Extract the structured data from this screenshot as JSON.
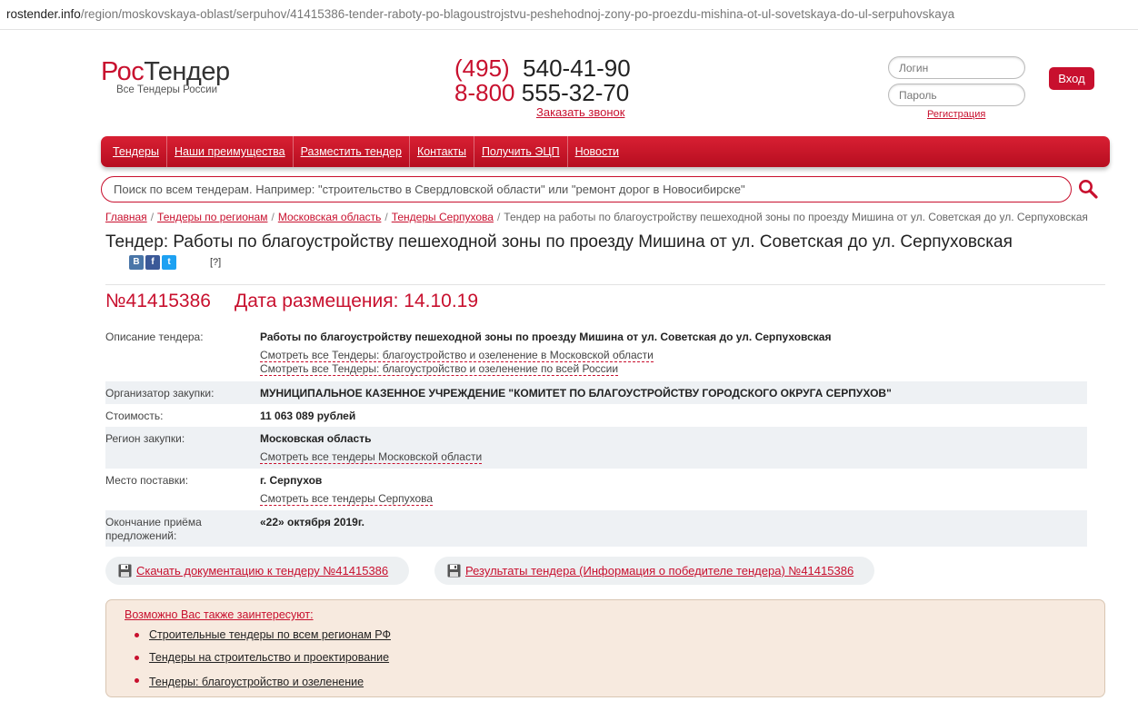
{
  "url": {
    "host": "rostender.info",
    "path": "/region/moskovskaya-oblast/serpuhov/41415386-tender-raboty-po-blagoustrojstvu-peshehodnoj-zony-po-proezdu-mishina-ot-ul-sovetskaya-do-ul-serpuhovskaya"
  },
  "header": {
    "brand_part1": "Рос",
    "brand_part2": "Тендер",
    "slogan": "Все Тендеры России",
    "phone1_code": "(495)",
    "phone1_number": "540-41-90",
    "phone2_code": "8-800",
    "phone2_number": "555-32-70",
    "callback": "Заказать звонок",
    "login_placeholder": "Логин",
    "password_placeholder": "Пароль",
    "register": "Регистрация",
    "login_button": "Вход"
  },
  "nav": {
    "items": [
      {
        "label": "Тендеры"
      },
      {
        "label": "Наши преимущества"
      },
      {
        "label": "Разместить тендер"
      },
      {
        "label": "Контакты"
      },
      {
        "label": "Получить ЭЦП"
      },
      {
        "label": "Новости"
      }
    ]
  },
  "search": {
    "placeholder": "Поиск по всем тендерам. Например: \"строительство в Свердловской области\" или \"ремонт дорог в Новосибирске\""
  },
  "breadcrumb": {
    "items": [
      "Главная",
      "Тендеры по регионам",
      "Московская область",
      "Тендеры Серпухова"
    ],
    "current": "Тендер на работы по благоустройству пешеходной зоны по проезду Мишина от ул. Советская до ул. Серпуховская",
    "separator": "/"
  },
  "page": {
    "title": "Тендер: Работы по благоустройству пешеходной зоны по проезду Мишина от ул. Советская до ул. Серпуховская",
    "help": "[?]",
    "social": {
      "vk": "В",
      "fb": "f",
      "tw": "t"
    },
    "tender_number": "№41415386",
    "date_label": "Дата размещения: 14.10.19"
  },
  "info": {
    "description_label": "Описание тендера:",
    "description_value": "Работы по благоустройству пешеходной зоны по проезду Мишина от ул. Советская до ул. Серпуховская",
    "description_link1": "Смотреть все Тендеры: благоустройство и озеленение в Московской области",
    "description_link2": "Смотреть все Тендеры: благоустройство и озеленение по всей России",
    "organizer_label": "Организатор закупки:",
    "organizer_value": "МУНИЦИПАЛЬНОЕ КАЗЕННОЕ УЧРЕЖДЕНИЕ \"КОМИТЕТ ПО БЛАГОУСТРОЙСТВУ ГОРОДСКОГО ОКРУГА СЕРПУХОВ\"",
    "cost_label": "Стоимость:",
    "cost_value": "11 063 089 рублей",
    "region_label": "Регион закупки:",
    "region_value": "Московская область",
    "region_link": "Смотреть все тендеры Московской области",
    "place_label": "Место поставки:",
    "place_value": "г. Серпухов",
    "place_link": "Смотреть все тендеры Серпухова",
    "deadline_label_1": "Окончание приёма",
    "deadline_label_2": "предложений:",
    "deadline_value": "«22» октября 2019г."
  },
  "actions": {
    "download": "Скачать документацию к тендеру №41415386",
    "results": "Результаты тендера (Информация о победителе тендера) №41415386"
  },
  "interest": {
    "title": "Возможно Вас также заинтересуют:",
    "items": [
      "Строительные тендеры по всем регионам РФ",
      "Тендеры на строительство и проектирование",
      "Тендеры: благоустройство и озеленение"
    ]
  },
  "colors": {
    "brand_red": "#c8102e",
    "row_alt": "#eef1f4",
    "interest_bg": "#f7eadf"
  }
}
